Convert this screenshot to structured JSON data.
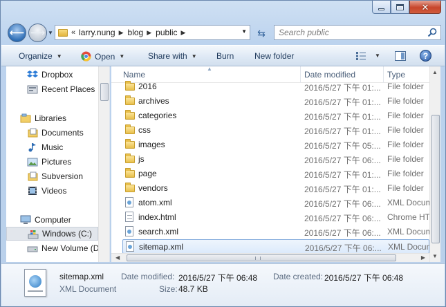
{
  "window": {
    "caption": {
      "minimize": "minimize",
      "maximize": "maximize",
      "close": "✕"
    }
  },
  "nav": {
    "breadcrumb_chevron": "«",
    "breadcrumbs": [
      "larry.nung",
      "blog",
      "public"
    ],
    "search_placeholder": "Search public"
  },
  "toolbar": {
    "organize": "Organize",
    "open": "Open",
    "share_with": "Share with",
    "burn": "Burn",
    "new_folder": "New folder",
    "help": "?"
  },
  "sidebar": {
    "items": [
      {
        "label": "Dropbox",
        "icon": "dropbox-icon"
      },
      {
        "label": "Recent Places",
        "icon": "recent-places-icon"
      },
      {
        "label": "Libraries",
        "icon": "libraries-icon"
      },
      {
        "label": "Documents",
        "icon": "documents-icon"
      },
      {
        "label": "Music",
        "icon": "music-icon"
      },
      {
        "label": "Pictures",
        "icon": "pictures-icon"
      },
      {
        "label": "Subversion",
        "icon": "subversion-icon"
      },
      {
        "label": "Videos",
        "icon": "videos-icon"
      },
      {
        "label": "Computer",
        "icon": "computer-icon"
      },
      {
        "label": "Windows  (C:)",
        "icon": "drive-c-icon",
        "selected": true
      },
      {
        "label": "New Volume (D",
        "icon": "drive-d-icon"
      }
    ]
  },
  "columns": {
    "name": "Name",
    "date": "Date modified",
    "type": "Type"
  },
  "files": [
    {
      "name": "2016",
      "date": "2016/5/27 下午 01:...",
      "type": "File folder",
      "kind": "folder"
    },
    {
      "name": "archives",
      "date": "2016/5/27 下午 01:...",
      "type": "File folder",
      "kind": "folder"
    },
    {
      "name": "categories",
      "date": "2016/5/27 下午 01:...",
      "type": "File folder",
      "kind": "folder"
    },
    {
      "name": "css",
      "date": "2016/5/27 下午 01:...",
      "type": "File folder",
      "kind": "folder"
    },
    {
      "name": "images",
      "date": "2016/5/27 下午 05:...",
      "type": "File folder",
      "kind": "folder"
    },
    {
      "name": "js",
      "date": "2016/5/27 下午 06:...",
      "type": "File folder",
      "kind": "folder"
    },
    {
      "name": "page",
      "date": "2016/5/27 下午 01:...",
      "type": "File folder",
      "kind": "folder"
    },
    {
      "name": "vendors",
      "date": "2016/5/27 下午 01:...",
      "type": "File folder",
      "kind": "folder"
    },
    {
      "name": "atom.xml",
      "date": "2016/5/27 下午 06:...",
      "type": "XML Docum",
      "kind": "xml"
    },
    {
      "name": "index.html",
      "date": "2016/5/27 下午 06:...",
      "type": "Chrome HT",
      "kind": "html"
    },
    {
      "name": "search.xml",
      "date": "2016/5/27 下午 06:...",
      "type": "XML Docum",
      "kind": "xml"
    },
    {
      "name": "sitemap.xml",
      "date": "2016/5/27 下午 06:...",
      "type": "XML Docum",
      "kind": "xml",
      "selected": true
    }
  ],
  "details": {
    "filename": "sitemap.xml",
    "filetype": "XML Document",
    "date_modified_label": "Date modified:",
    "date_modified": "2016/5/27 下午 06:48",
    "date_created_label": "Date created:",
    "date_created": "2016/5/27 下午 06:48",
    "size_label": "Size:",
    "size": "48.7 KB"
  },
  "colors": {
    "accent": "#2e6db4",
    "selection": "#dceafb",
    "frame": "#c6daf0"
  }
}
